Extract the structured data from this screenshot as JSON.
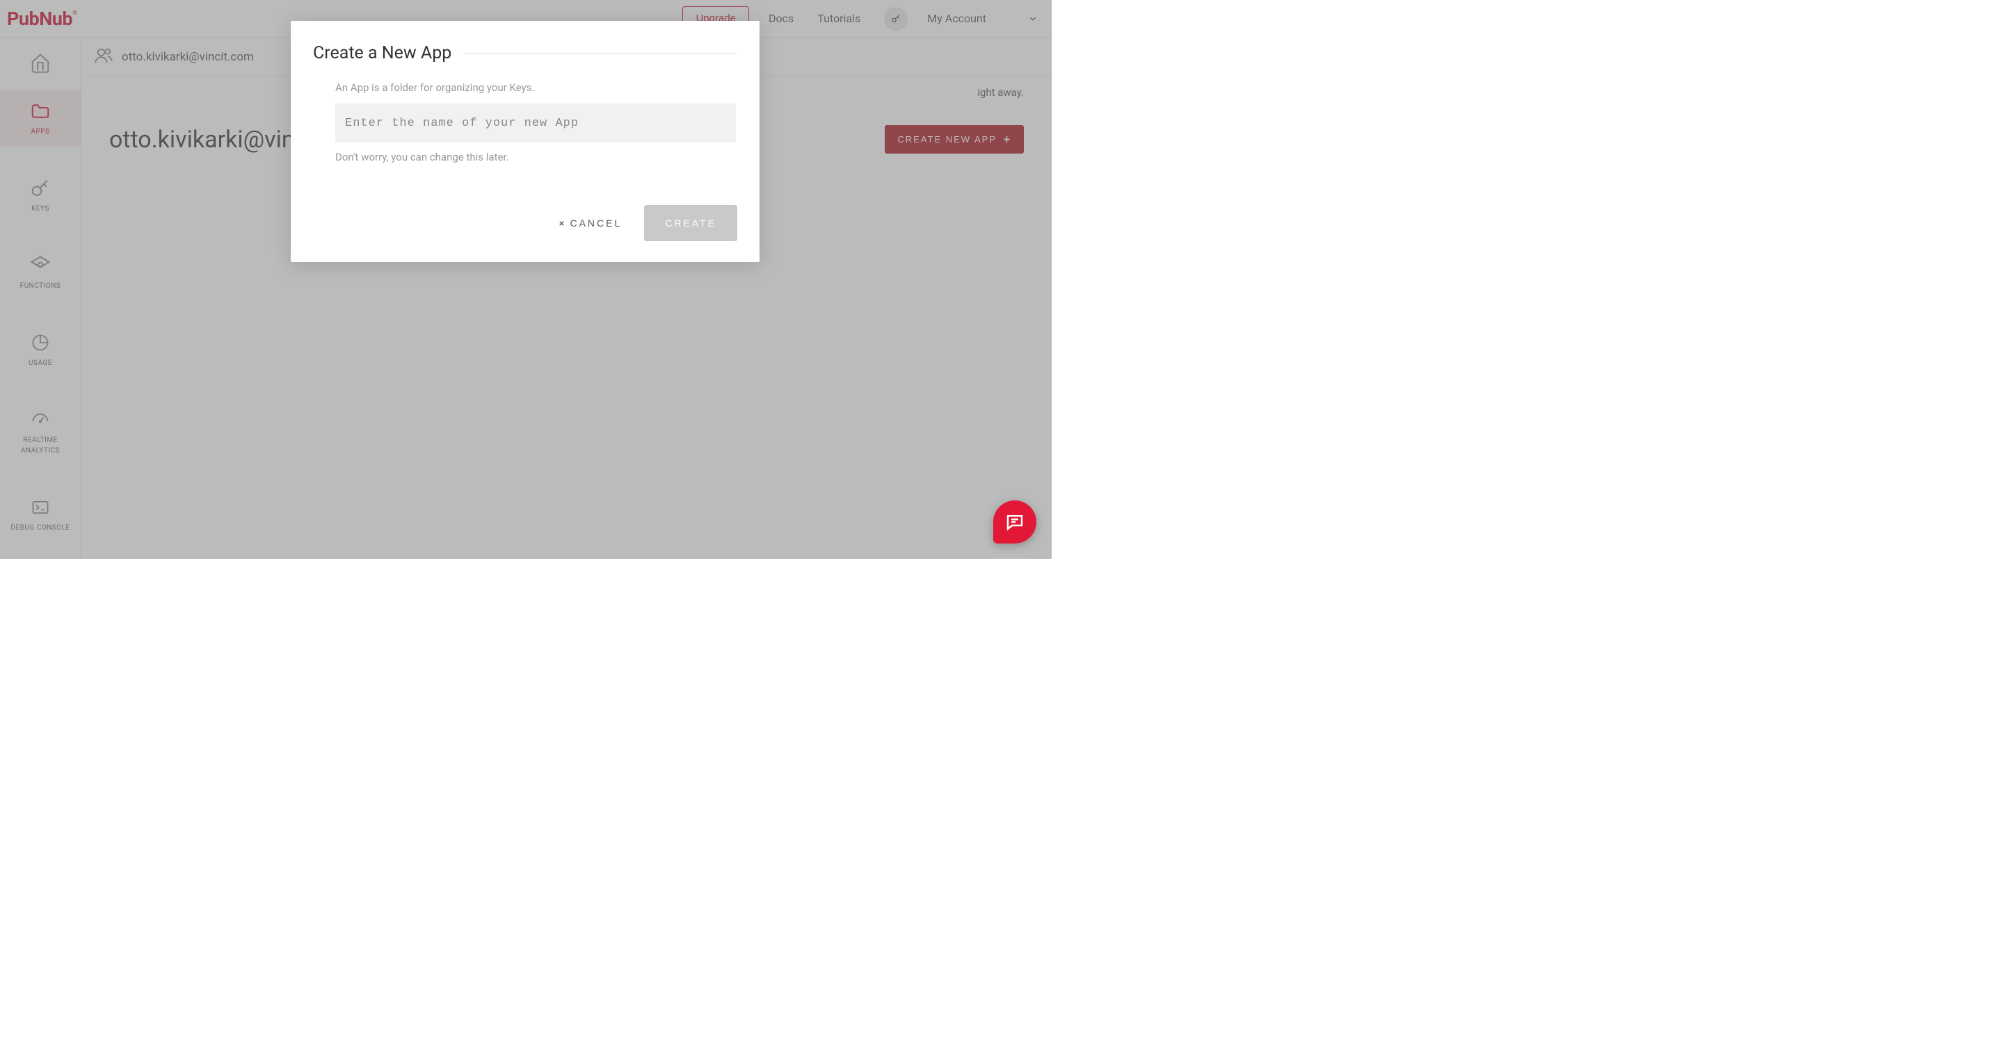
{
  "brand": "PubNub",
  "topbar": {
    "upgrade_label": "Upgrade",
    "docs_label": "Docs",
    "tutorials_label": "Tutorials",
    "my_account_label": "My Account"
  },
  "sidebar": {
    "home": "",
    "apps": "APPS",
    "keys": "KEYS",
    "functions": "FUNCTIONS",
    "usage": "USAGE",
    "realtime": "REALTIME ANALYTICS",
    "debug": "DEBUG CONSOLE"
  },
  "breadcrumb": {
    "email": "otto.kivikarki@vincit.com"
  },
  "banner_text_tail": "ight away.",
  "content": {
    "title": "otto.kivikarki@vincit.com",
    "create_btn_label": "CREATE NEW APP"
  },
  "modal": {
    "title": "Create a New App",
    "description": "An App is a folder for organizing your Keys.",
    "placeholder": "Enter the name of your new App",
    "hint": "Don't worry, you can change this later.",
    "cancel_label": "CANCEL",
    "create_label": "CREATE"
  }
}
